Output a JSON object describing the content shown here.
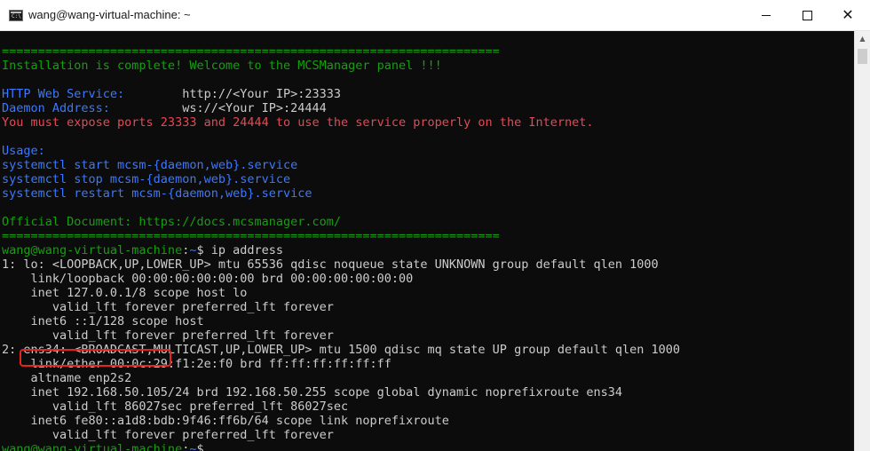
{
  "window": {
    "title": "wang@wang-virtual-machine: ~",
    "icon": "console-icon",
    "controls": {
      "minimize": "minimize-icon",
      "maximize": "maximize-icon",
      "close": "close-icon",
      "close_glyph": "✕"
    }
  },
  "colors": {
    "green": "#13a10e",
    "white": "#cccccc",
    "red": "#e74856",
    "blue": "#3b78ff",
    "highlight_box": "#e3261c"
  },
  "terminal": {
    "lines": [
      {
        "segments": [
          {
            "text": "=====================================================================",
            "color": "green"
          }
        ]
      },
      {
        "segments": [
          {
            "text": "Installation is complete! Welcome to the MCSManager panel !!!",
            "color": "green"
          }
        ]
      },
      {
        "segments": [
          {
            "text": "",
            "color": "white"
          }
        ]
      },
      {
        "segments": [
          {
            "text": "HTTP Web Service:        ",
            "color": "blue"
          },
          {
            "text": "http://<Your IP>:23333",
            "color": "white"
          }
        ]
      },
      {
        "segments": [
          {
            "text": "Daemon Address:          ",
            "color": "blue"
          },
          {
            "text": "ws://<Your IP>:24444",
            "color": "white"
          }
        ]
      },
      {
        "segments": [
          {
            "text": "You must expose ports 23333 and 24444 to use the service properly on the Internet.",
            "color": "red"
          }
        ]
      },
      {
        "segments": [
          {
            "text": "",
            "color": "white"
          }
        ]
      },
      {
        "segments": [
          {
            "text": "Usage:",
            "color": "blue"
          }
        ]
      },
      {
        "segments": [
          {
            "text": "systemctl start mcsm-{daemon,web}.service",
            "color": "blue"
          }
        ]
      },
      {
        "segments": [
          {
            "text": "systemctl stop mcsm-{daemon,web}.service",
            "color": "blue"
          }
        ]
      },
      {
        "segments": [
          {
            "text": "systemctl restart mcsm-{daemon,web}.service",
            "color": "blue"
          }
        ]
      },
      {
        "segments": [
          {
            "text": "",
            "color": "white"
          }
        ]
      },
      {
        "segments": [
          {
            "text": "Official Document: https://docs.mcsmanager.com/",
            "color": "green"
          }
        ]
      },
      {
        "segments": [
          {
            "text": "=====================================================================",
            "color": "green"
          }
        ]
      },
      {
        "segments": [
          {
            "text": "wang@wang-virtual-machine",
            "color": "green"
          },
          {
            "text": ":",
            "color": "white"
          },
          {
            "text": "~",
            "color": "blue"
          },
          {
            "text": "$ ip address",
            "color": "white"
          }
        ]
      },
      {
        "segments": [
          {
            "text": "1: lo: <LOOPBACK,UP,LOWER_UP> mtu 65536 qdisc noqueue state UNKNOWN group default qlen 1000",
            "color": "white"
          }
        ]
      },
      {
        "segments": [
          {
            "text": "    link/loopback 00:00:00:00:00:00 brd 00:00:00:00:00:00",
            "color": "white"
          }
        ]
      },
      {
        "segments": [
          {
            "text": "    inet 127.0.0.1/8 scope host lo",
            "color": "white"
          }
        ]
      },
      {
        "segments": [
          {
            "text": "       valid_lft forever preferred_lft forever",
            "color": "white"
          }
        ]
      },
      {
        "segments": [
          {
            "text": "    inet6 ::1/128 scope host",
            "color": "white"
          }
        ]
      },
      {
        "segments": [
          {
            "text": "       valid_lft forever preferred_lft forever",
            "color": "white"
          }
        ]
      },
      {
        "segments": [
          {
            "text": "2: ens34: <BROADCAST,MULTICAST,UP,LOWER_UP> mtu 1500 qdisc mq state UP group default qlen 1000",
            "color": "white"
          }
        ]
      },
      {
        "segments": [
          {
            "text": "    link/ether 00:0c:29:f1:2e:f0 brd ff:ff:ff:ff:ff:ff",
            "color": "white"
          }
        ]
      },
      {
        "segments": [
          {
            "text": "    altname enp2s2",
            "color": "white"
          }
        ]
      },
      {
        "segments": [
          {
            "text": "    inet 192.168.50.105/24 brd 192.168.50.255 scope global dynamic noprefixroute ens34",
            "color": "white"
          }
        ]
      },
      {
        "segments": [
          {
            "text": "       valid_lft 86027sec preferred_lft 86027sec",
            "color": "white"
          }
        ]
      },
      {
        "segments": [
          {
            "text": "    inet6 fe80::a1d8:bdb:9f46:ff6b/64 scope link noprefixroute",
            "color": "white"
          }
        ]
      },
      {
        "segments": [
          {
            "text": "       valid_lft forever preferred_lft forever",
            "color": "white"
          }
        ]
      },
      {
        "segments": [
          {
            "text": "wang@wang-virtual-machine",
            "color": "green"
          },
          {
            "text": ":",
            "color": "white"
          },
          {
            "text": "~",
            "color": "blue"
          },
          {
            "text": "$",
            "color": "white"
          }
        ]
      }
    ]
  },
  "scrollbar": {
    "up_glyph": "▲"
  }
}
